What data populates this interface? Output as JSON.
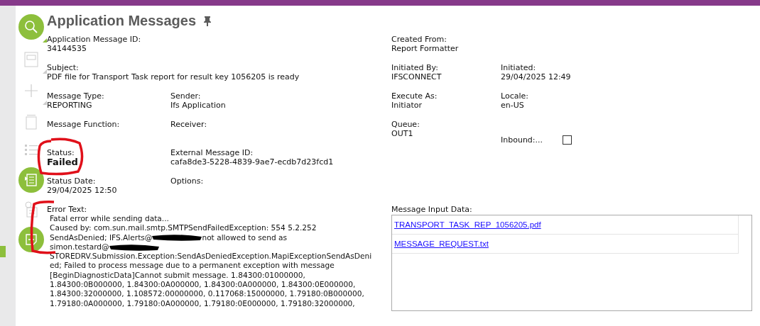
{
  "page": {
    "title": "Application Messages"
  },
  "left_rows": [
    [
      {
        "label": "Application Message ID:",
        "value": "34144535"
      }
    ],
    [
      {
        "label": "Subject:",
        "value": "PDF file for Transport Task report for result key 1056205 is ready"
      }
    ],
    [
      {
        "label": "Message Type:",
        "value": "REPORTING"
      },
      {
        "label": "Sender:",
        "value": "Ifs Application"
      }
    ],
    [
      {
        "label": "Message Function:"
      },
      {
        "label": "Receiver:"
      }
    ],
    [
      {
        "label": "Status:",
        "value": "Failed",
        "kind": "status"
      },
      {
        "label": "External Message ID:",
        "value": "cafa8de3-5228-4839-9ae7-ecdb7d23fcd1"
      }
    ],
    [
      {
        "label": "Status Date:",
        "value": "29/04/2025 12:50"
      },
      {
        "label": "Options:"
      }
    ]
  ],
  "right_rows": [
    [
      {
        "label": "Created From:",
        "value": "Report Formatter"
      }
    ],
    [
      {
        "label": "Initiated By:",
        "value": "IFSCONNECT"
      },
      {
        "label": "Initiated:",
        "value": "29/04/2025 12:49"
      }
    ],
    [
      {
        "label": "Execute As:",
        "value": "Initiator"
      },
      {
        "label": "Locale:",
        "value": "en-US"
      }
    ],
    [
      {
        "label": "Queue:",
        "value": "OUT1"
      },
      {
        "label": "Inbound:...",
        "kind": "checkbox",
        "checked": false
      }
    ]
  ],
  "error_text": {
    "label": "Error Text:",
    "lines": [
      {
        "text": "Fatal error while sending data..."
      },
      {
        "text": "Caused by: com.sun.mail.smtp.SMTPSendFailedException: 554 5.2.252"
      },
      {
        "text": "SendAsDenied; IFS.Alerts@",
        "redacted": true,
        "after": "not allowed to send as"
      },
      {
        "text": "simon.testard@",
        "redacted": true
      },
      {
        "text": "STOREDRV.Submission.Exception:SendAsDeniedException.MapiExceptionSendAsDeni"
      },
      {
        "text": "ed; Failed to process message due to a permanent exception with message"
      },
      {
        "text": "[BeginDiagnosticData]Cannot submit message. 1.84300:01000000,"
      },
      {
        "text": "1.84300:0B000000, 1.84300:0A000000, 1.84300:0A000000, 1.84300:0E000000,"
      },
      {
        "text": "1.84300:32000000, 1.108572:00000000, 0.117068:15000000, 1.79180:0B000000,"
      },
      {
        "text": "1.79180:0A000000, 1.79180:0A000000, 1.79180:0E000000, 1.79180:32000000,"
      }
    ]
  },
  "message_input_data": {
    "label": "Message Input Data:",
    "files": [
      "TRANSPORT_TASK_REP_1056205.pdf",
      "MESSAGE_REQUEST.txt"
    ]
  }
}
